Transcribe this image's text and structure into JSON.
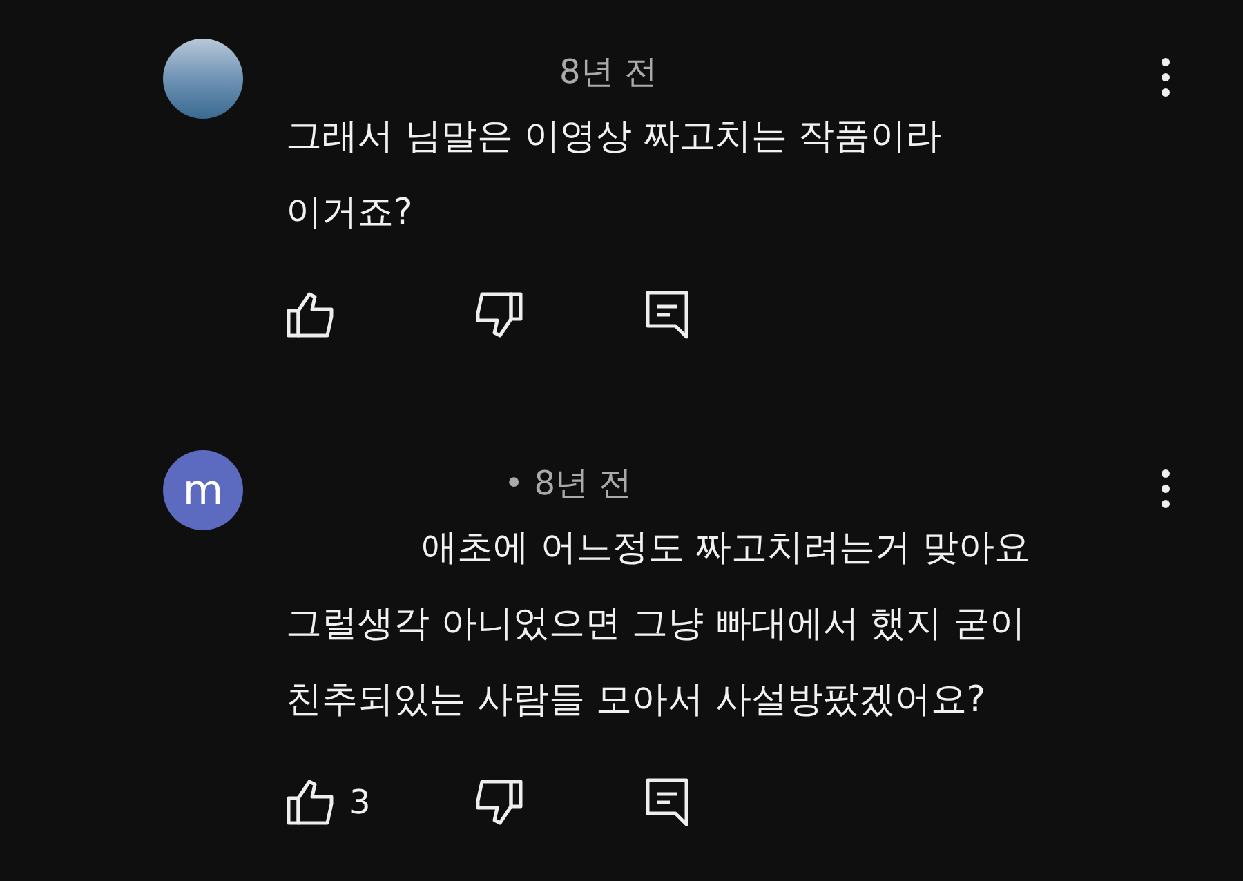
{
  "comments": [
    {
      "avatar": {
        "kind": "photo"
      },
      "timestamp": "8년 전",
      "indented": false,
      "text": "그래서 님말은 이영상 짜고치는 작품이라\n이거죠?"
    },
    {
      "avatar": {
        "kind": "letter",
        "letter": "m",
        "color": "#5c6bc0"
      },
      "timestamp": "• 8년 전",
      "indented": true,
      "text": "애초에 어느정도 짜고치려는거 맞아요\n그럴생각 아니었으면 그냥 빠대에서 했지 굳이\n친추되있는 사람들 모아서 사설방팠겠어요?",
      "likes": "3"
    }
  ]
}
